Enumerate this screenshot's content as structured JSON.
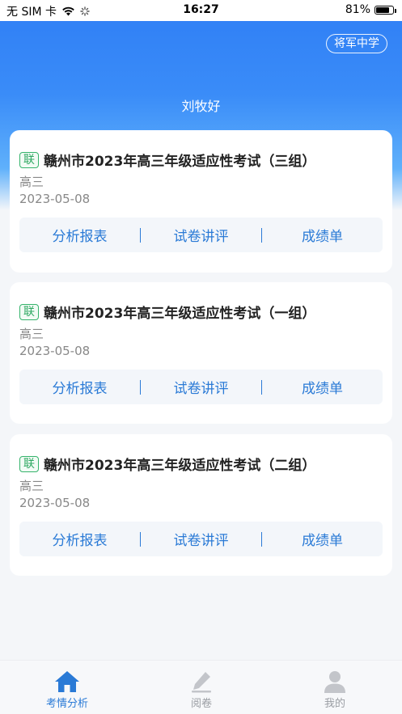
{
  "status_bar": {
    "carrier": "无 SIM 卡",
    "time": "16:27",
    "battery": "81%",
    "battery_level": 0.81
  },
  "header": {
    "school_button": "将军中学",
    "greeting": "刘牧好"
  },
  "exams": [
    {
      "tag": "联",
      "title": "赣州市2023年高三年级适应性考试（三组）",
      "grade": "高三",
      "date": "2023-05-08",
      "actions": [
        "分析报表",
        "试卷讲评",
        "成绩单"
      ]
    },
    {
      "tag": "联",
      "title": "赣州市2023年高三年级适应性考试（一组）",
      "grade": "高三",
      "date": "2023-05-08",
      "actions": [
        "分析报表",
        "试卷讲评",
        "成绩单"
      ]
    },
    {
      "tag": "联",
      "title": "赣州市2023年高三年级适应性考试（二组）",
      "grade": "高三",
      "date": "2023-05-08",
      "actions": [
        "分析报表",
        "试卷讲评",
        "成绩单"
      ]
    }
  ],
  "tabbar": {
    "tabs": [
      {
        "label": "考情分析",
        "icon": "home-icon",
        "active": true
      },
      {
        "label": "阅卷",
        "icon": "pencil-icon",
        "active": false
      },
      {
        "label": "我的",
        "icon": "person-icon",
        "active": false
      }
    ]
  },
  "colors": {
    "accent": "#2a7ad6",
    "header_blue": "#2f7ef5",
    "tag_green": "#35b36b"
  }
}
